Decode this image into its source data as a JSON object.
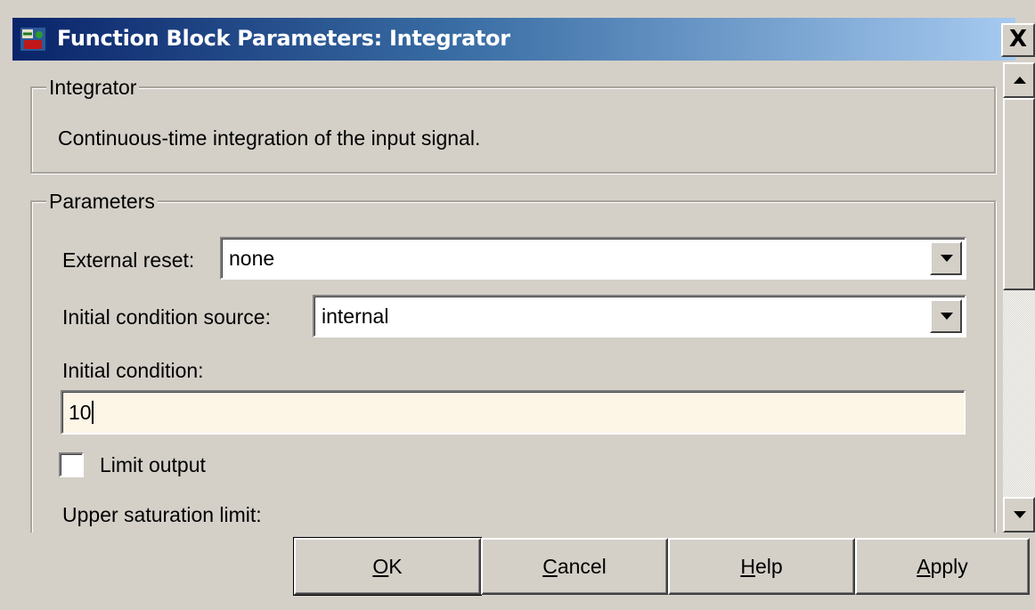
{
  "window": {
    "title": "Function Block Parameters: Integrator",
    "close_label": "X"
  },
  "description_group": {
    "title": "Integrator",
    "text": "Continuous-time integration of the input signal."
  },
  "parameters_group": {
    "title": "Parameters",
    "external_reset": {
      "label": "External reset:",
      "value": "none"
    },
    "initial_condition_source": {
      "label": "Initial condition source:",
      "value": "internal"
    },
    "initial_condition": {
      "label": "Initial condition:",
      "value": "10"
    },
    "limit_output": {
      "label": "Limit output",
      "checked": false
    },
    "upper_saturation_limit": {
      "label": "Upper saturation limit:"
    }
  },
  "buttons": {
    "ok": {
      "mnemonic": "O",
      "rest": "K"
    },
    "cancel": {
      "mnemonic": "C",
      "rest": "ancel"
    },
    "help": {
      "mnemonic": "H",
      "rest": "elp"
    },
    "apply": {
      "mnemonic": "A",
      "rest": "pply"
    }
  },
  "colors": {
    "title_gradient_start": "#0a246a",
    "title_gradient_end": "#a6caf0",
    "dialog_face": "#d4d0c8",
    "edit_background": "#fdf5e6"
  },
  "icons": [
    "simulink-block-icon",
    "close-icon",
    "chevron-down-icon",
    "scroll-up-icon",
    "scroll-down-icon"
  ]
}
